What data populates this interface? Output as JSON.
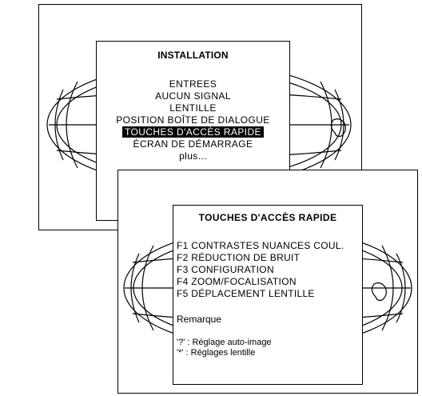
{
  "installation_menu": {
    "title": "INSTALLATION",
    "items": [
      "ENTREES",
      "AUCUN SIGNAL",
      "LENTILLE",
      "POSITION BOÎTE DE DIALOGUE",
      "TOUCHES D'ACCÈS RAPIDE",
      "ÉCRAN DE DÉMARRAGE",
      "plus..."
    ],
    "selected_index": 4
  },
  "hotkeys_menu": {
    "title": "TOUCHES D'ACCÈS RAPIDE",
    "items": [
      "F1 CONTRASTES NUANCES COUL.",
      "F2 RÉDUCTION DE BRUIT",
      "F3 CONFIGURATION",
      "F4 ZOOM/FOCALISATION",
      "F5 DÉPLACEMENT LENTILLE"
    ],
    "note_label": "Remarque",
    "notes": [
      "'?'  :  Réglage auto-image",
      "'*'  :  Réglages lentille"
    ]
  },
  "colors": {
    "background": "#ffffff",
    "line": "#000000",
    "highlight_bg": "#000000",
    "highlight_text": "#ffffff"
  },
  "icons": [
    "globe-icon"
  ]
}
